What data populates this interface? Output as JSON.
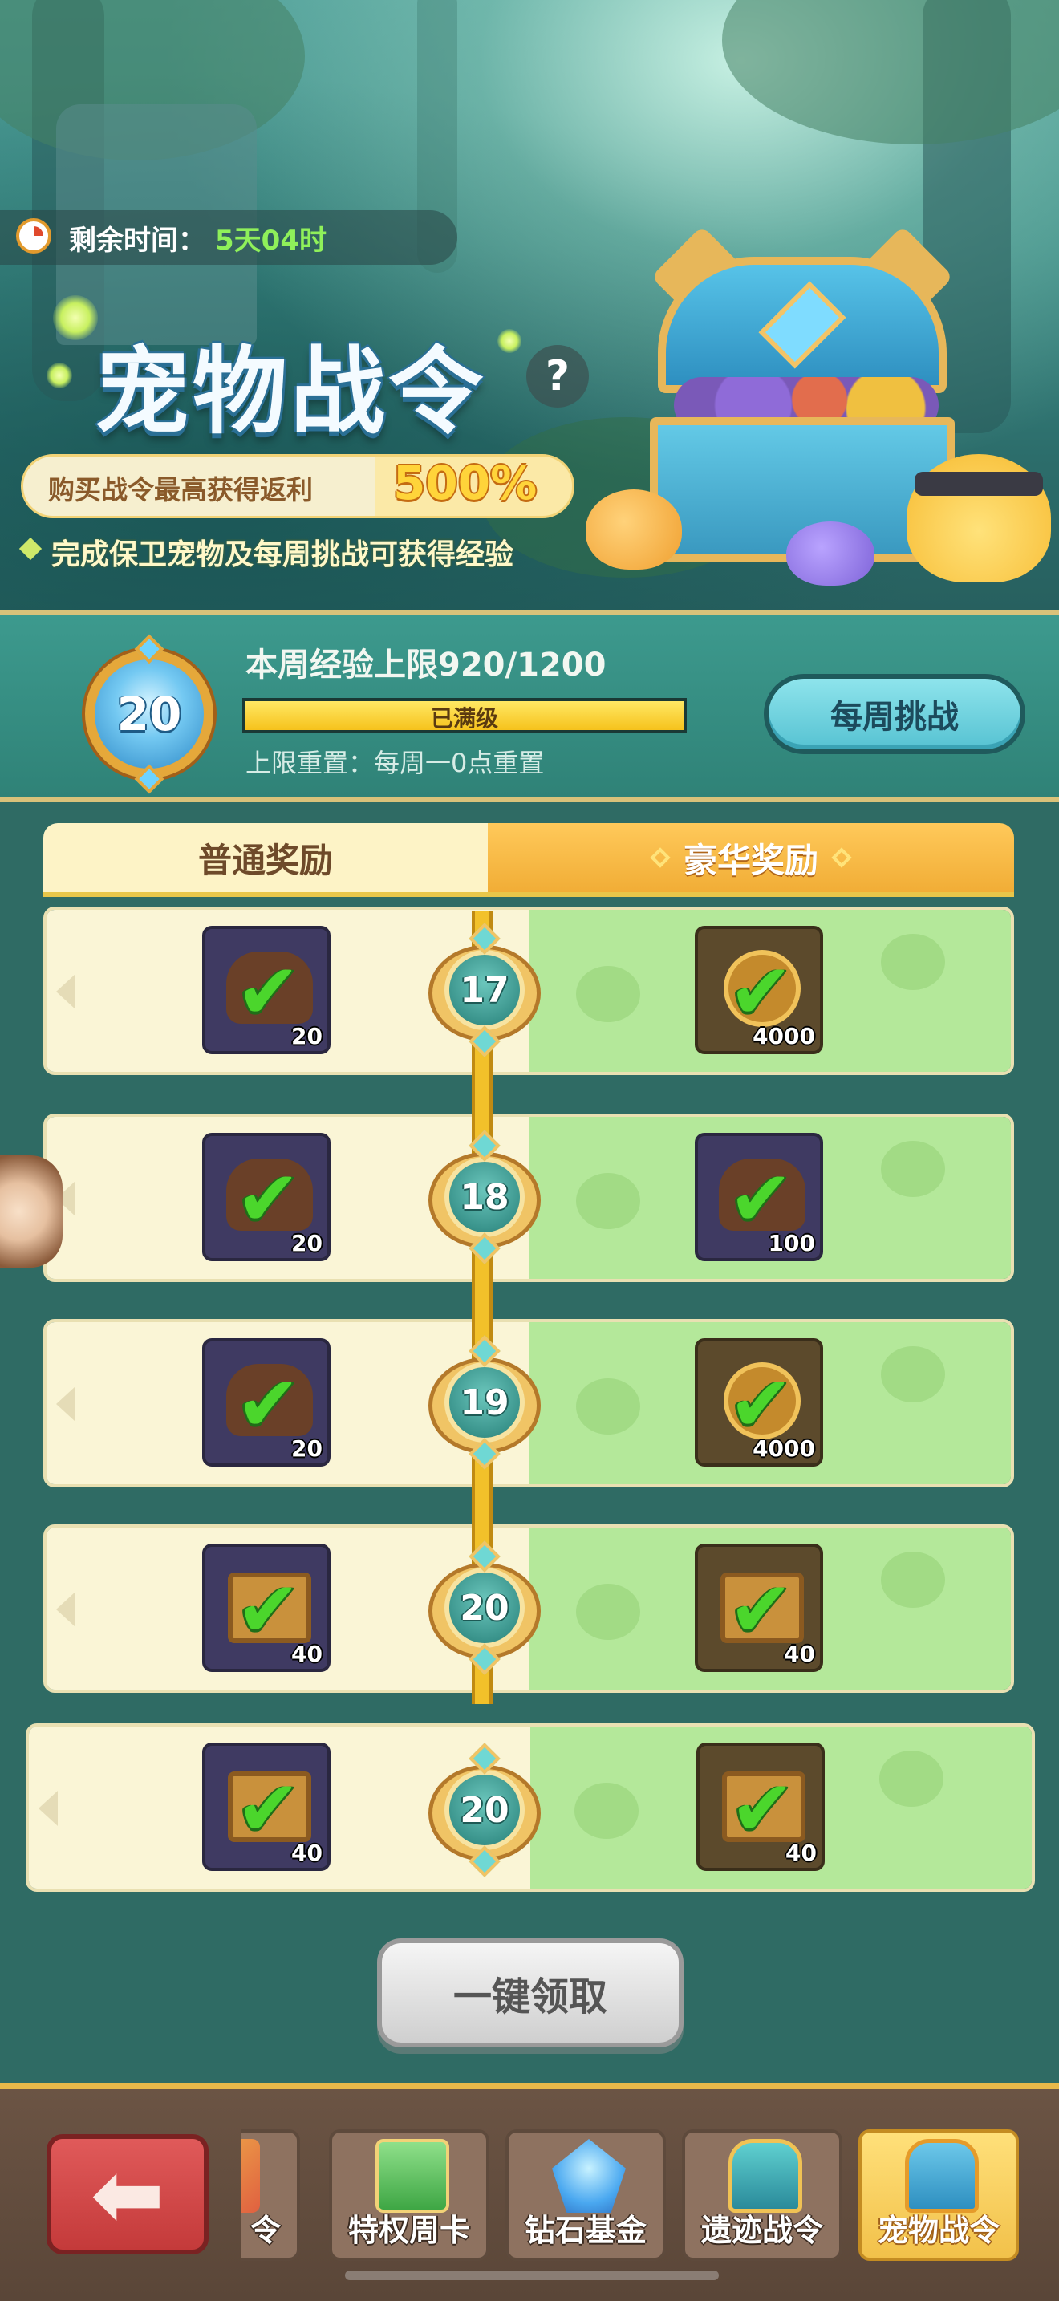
{
  "banner": {
    "timer_label": "剩余时间：",
    "timer_value": "5天04时",
    "title": "宠物战令",
    "rebate_text": "购买战令最高获得返利",
    "rebate_value": "500%",
    "exp_hint": "完成保卫宠物及每周挑战可获得经验",
    "help_icon": "?"
  },
  "exp_panel": {
    "level": "20",
    "weekly_cap": "本周经验上限920/1200",
    "progress_fraction": 1.0,
    "bar_text": "已满级",
    "reset_text": "上限重置：每周一0点重置",
    "weekly_button": "每周挑战"
  },
  "tabs": {
    "normal": "普通奖励",
    "luxury": "豪华奖励"
  },
  "rows": [
    {
      "level": "17",
      "normal_qty": "20",
      "luxury_qty": "4000",
      "normal_icon": "food-bag",
      "luxury_icon": "gold-coin",
      "claimed": true
    },
    {
      "level": "18",
      "normal_qty": "20",
      "luxury_qty": "100",
      "normal_icon": "food-bag",
      "luxury_icon": "food-bag",
      "claimed": true
    },
    {
      "level": "19",
      "normal_qty": "20",
      "luxury_qty": "4000",
      "normal_icon": "food-bag",
      "luxury_icon": "gold-coin",
      "claimed": true
    },
    {
      "level": "20",
      "normal_qty": "40",
      "luxury_qty": "40",
      "normal_icon": "cat-chest",
      "luxury_icon": "cat-chest",
      "claimed": true
    },
    {
      "level": "20",
      "normal_qty": "40",
      "luxury_qty": "40",
      "normal_icon": "cat-chest",
      "luxury_icon": "cat-chest",
      "claimed": true
    }
  ],
  "claim_all": "一键领取",
  "nav": {
    "partial_tab": "令",
    "tabs": [
      {
        "label": "特权周卡",
        "icon": "crown-card-icon"
      },
      {
        "label": "钻石基金",
        "icon": "diamond-pile-icon"
      },
      {
        "label": "遗迹战令",
        "icon": "relic-chest-icon"
      },
      {
        "label": "宠物战令",
        "icon": "pet-chest-icon",
        "active": true
      }
    ],
    "back_icon": "back-arrow-icon"
  },
  "colors": {
    "accent_gold": "#f2c12a",
    "luxury_green": "#b4e89a",
    "normal_cream": "#faf5d6",
    "check_green": "#4bd62c",
    "back_red": "#d04848"
  }
}
